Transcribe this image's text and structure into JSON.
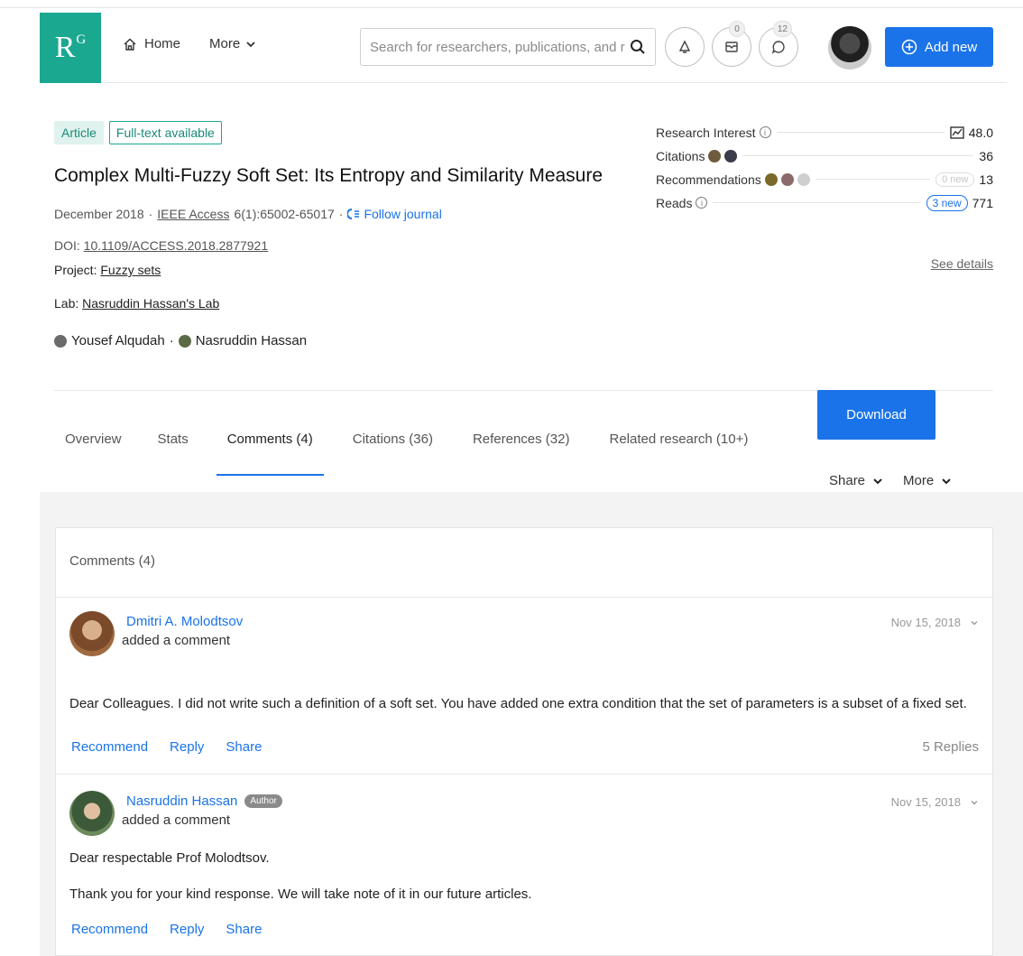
{
  "header": {
    "logo_main": "R",
    "logo_sup": "G",
    "home_label": "Home",
    "more_label": "More",
    "search_placeholder": "Search for researchers, publications, and r",
    "messages_count": "0",
    "questions_count": "12",
    "add_new_label": "Add new",
    "colors": {
      "brand": "#1aa891",
      "accent": "#1a73e8"
    }
  },
  "article": {
    "type_label": "Article",
    "fulltext_label": "Full-text available",
    "title": "Complex Multi-Fuzzy Soft Set: Its Entropy and Similarity Measure",
    "date": "December 2018",
    "journal": "IEEE Access",
    "volume_pages": "6(1):65002-65017",
    "follow_label": "Follow journal",
    "doi_prefix": "DOI:",
    "doi": "10.1109/ACCESS.2018.2877921",
    "project_prefix": "Project:",
    "project": "Fuzzy sets",
    "lab_prefix": "Lab:",
    "lab": "Nasruddin Hassan's Lab",
    "authors": [
      "Yousef Alqudah",
      "Nasruddin Hassan"
    ]
  },
  "stats": {
    "research_interest_label": "Research Interest",
    "research_interest_value": "48.0",
    "citations_label": "Citations",
    "citations_value": "36",
    "recommendations_label": "Recommendations",
    "recommendations_new": "0 new",
    "recommendations_value": "13",
    "reads_label": "Reads",
    "reads_new": "3 new",
    "reads_value": "771",
    "see_details": "See details"
  },
  "tabs": [
    {
      "label": "Overview"
    },
    {
      "label": "Stats"
    },
    {
      "label": "Comments (4)"
    },
    {
      "label": "Citations (36)"
    },
    {
      "label": "References (32)"
    },
    {
      "label": "Related research (10+)"
    }
  ],
  "actions": {
    "download_label": "Download",
    "share_label": "Share",
    "more_label": "More"
  },
  "comments": {
    "heading": "Comments (4)",
    "items": [
      {
        "name": "Dmitri A. Molodtsov",
        "action": "added a comment",
        "date": "Nov 15, 2018",
        "paragraphs": [
          "Dear Colleagues. I did not write such a definition of a soft set. You have added one extra condition that the set of parameters is a subset of a fixed set."
        ],
        "recommend": "Recommend",
        "reply": "Reply",
        "share": "Share",
        "replies": "5 Replies"
      },
      {
        "name": "Nasruddin Hassan",
        "badge": "Author",
        "action": "added a comment",
        "date": "Nov 15, 2018",
        "paragraphs": [
          "Dear respectable Prof Molodtsov.",
          "Thank you for your kind response. We will take note of it in our future articles."
        ],
        "recommend": "Recommend",
        "reply": "Reply",
        "share": "Share"
      }
    ]
  }
}
